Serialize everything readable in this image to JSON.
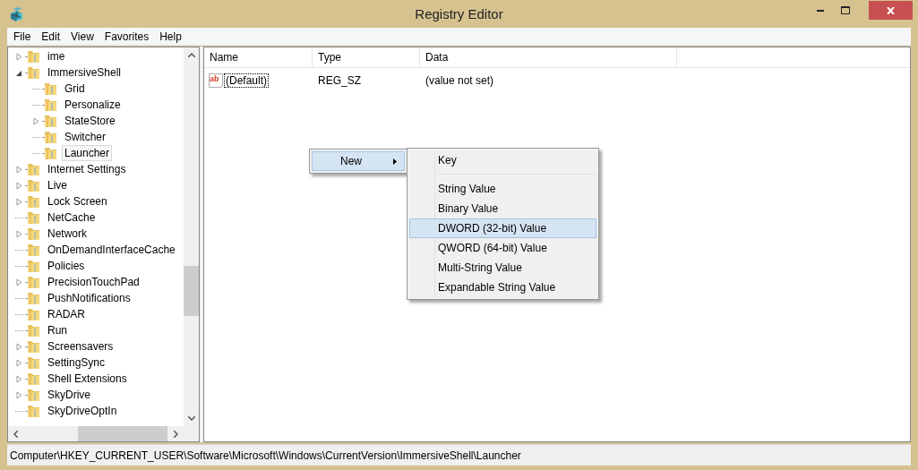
{
  "window": {
    "title": "Registry Editor"
  },
  "menu": [
    "File",
    "Edit",
    "View",
    "Favorites",
    "Help"
  ],
  "tree": {
    "items": [
      {
        "label": "ime",
        "expandable": true,
        "expanded": false,
        "selected": false
      },
      {
        "label": "ImmersiveShell",
        "expandable": true,
        "expanded": true,
        "selected": false,
        "children": [
          {
            "label": "Grid",
            "expandable": false,
            "selected": false
          },
          {
            "label": "Personalize",
            "expandable": false,
            "selected": false
          },
          {
            "label": "StateStore",
            "expandable": true,
            "expanded": false,
            "selected": false
          },
          {
            "label": "Switcher",
            "expandable": false,
            "selected": false
          },
          {
            "label": "Launcher",
            "expandable": false,
            "selected": true
          }
        ]
      },
      {
        "label": "Internet Settings",
        "expandable": true,
        "expanded": false,
        "selected": false
      },
      {
        "label": "Live",
        "expandable": true,
        "expanded": false,
        "selected": false
      },
      {
        "label": "Lock Screen",
        "expandable": true,
        "expanded": false,
        "selected": false
      },
      {
        "label": "NetCache",
        "expandable": false,
        "selected": false
      },
      {
        "label": "Network",
        "expandable": true,
        "expanded": false,
        "selected": false
      },
      {
        "label": "OnDemandInterfaceCache",
        "expandable": false,
        "selected": false
      },
      {
        "label": "Policies",
        "expandable": false,
        "selected": false
      },
      {
        "label": "PrecisionTouchPad",
        "expandable": true,
        "expanded": false,
        "selected": false
      },
      {
        "label": "PushNotifications",
        "expandable": false,
        "selected": false
      },
      {
        "label": "RADAR",
        "expandable": false,
        "selected": false
      },
      {
        "label": "Run",
        "expandable": false,
        "selected": false
      },
      {
        "label": "Screensavers",
        "expandable": true,
        "expanded": false,
        "selected": false
      },
      {
        "label": "SettingSync",
        "expandable": true,
        "expanded": false,
        "selected": false
      },
      {
        "label": "Shell Extensions",
        "expandable": true,
        "expanded": false,
        "selected": false
      },
      {
        "label": "SkyDrive",
        "expandable": true,
        "expanded": false,
        "selected": false
      },
      {
        "label": "SkyDriveOptIn",
        "expandable": false,
        "selected": false
      }
    ]
  },
  "values": {
    "columns": [
      "Name",
      "Type",
      "Data"
    ],
    "rows": [
      {
        "icon": "ab",
        "name": "(Default)",
        "type": "REG_SZ",
        "data": "(value not set)",
        "focused": true
      }
    ]
  },
  "context_menu": {
    "items": [
      {
        "label": "New",
        "selected": true
      }
    ]
  },
  "submenu": {
    "items": [
      {
        "kind": "item",
        "label": "Key",
        "selected": false
      },
      {
        "kind": "separator"
      },
      {
        "kind": "item",
        "label": "String Value",
        "selected": false
      },
      {
        "kind": "item",
        "label": "Binary Value",
        "selected": false
      },
      {
        "kind": "item",
        "label": "DWORD (32-bit) Value",
        "selected": true
      },
      {
        "kind": "item",
        "label": "QWORD (64-bit) Value",
        "selected": false
      },
      {
        "kind": "item",
        "label": "Multi-String Value",
        "selected": false
      },
      {
        "kind": "item",
        "label": "Expandable String Value",
        "selected": false
      }
    ]
  },
  "status_bar": "Computer\\HKEY_CURRENT_USER\\Software\\Microsoft\\Windows\\CurrentVersion\\ImmersiveShell\\Launcher"
}
